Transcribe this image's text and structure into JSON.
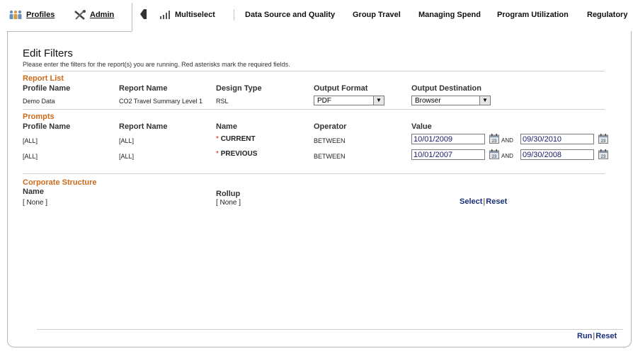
{
  "toolbar": {
    "profiles": "Profiles",
    "admin": "Admin",
    "multiselect": "Multiselect",
    "items": [
      "Data Source and Quality",
      "Group Travel",
      "Managing Spend",
      "Program Utilization",
      "Regulatory"
    ]
  },
  "page": {
    "title": "Edit Filters",
    "subtitle": "Please enter the filters for the report(s) you are running. Red asterisks mark the required fields."
  },
  "report_list": {
    "heading": "Report List",
    "columns": [
      "Profile Name",
      "Report Name",
      "Design Type",
      "Output Format",
      "Output Destination"
    ],
    "row": {
      "profile": "Demo Data",
      "report": "CO2 Travel Summary Level 1",
      "design": "RSL",
      "output_format": "PDF",
      "output_destination": "Browser"
    }
  },
  "prompts": {
    "heading": "Prompts",
    "columns": [
      "Profile Name",
      "Report Name",
      "Name",
      "Operator",
      "Value"
    ],
    "rows": [
      {
        "profile": "[ALL]",
        "report": "[ALL]",
        "required": "*",
        "name": "CURRENT",
        "operator": "BETWEEN",
        "from": "10/01/2009",
        "and": "AND",
        "to": "09/30/2010"
      },
      {
        "profile": "[ALL]",
        "report": "[ALL]",
        "required": "*",
        "name": "PREVIOUS",
        "operator": "BETWEEN",
        "from": "10/01/2007",
        "and": "AND",
        "to": "09/30/2008"
      }
    ]
  },
  "corporate": {
    "heading": "Corporate Structure",
    "name_label": "Name",
    "name_value": "[ None ]",
    "rollup_label": "Rollup",
    "rollup_value": "[ None ]",
    "select": "Select",
    "divider": "|",
    "reset": "Reset"
  },
  "footer": {
    "run": "Run",
    "divider": "|",
    "reset": "Reset"
  },
  "colors": {
    "section": "#cc6a1a",
    "link": "#1a2f7a",
    "required": "#d02020"
  }
}
